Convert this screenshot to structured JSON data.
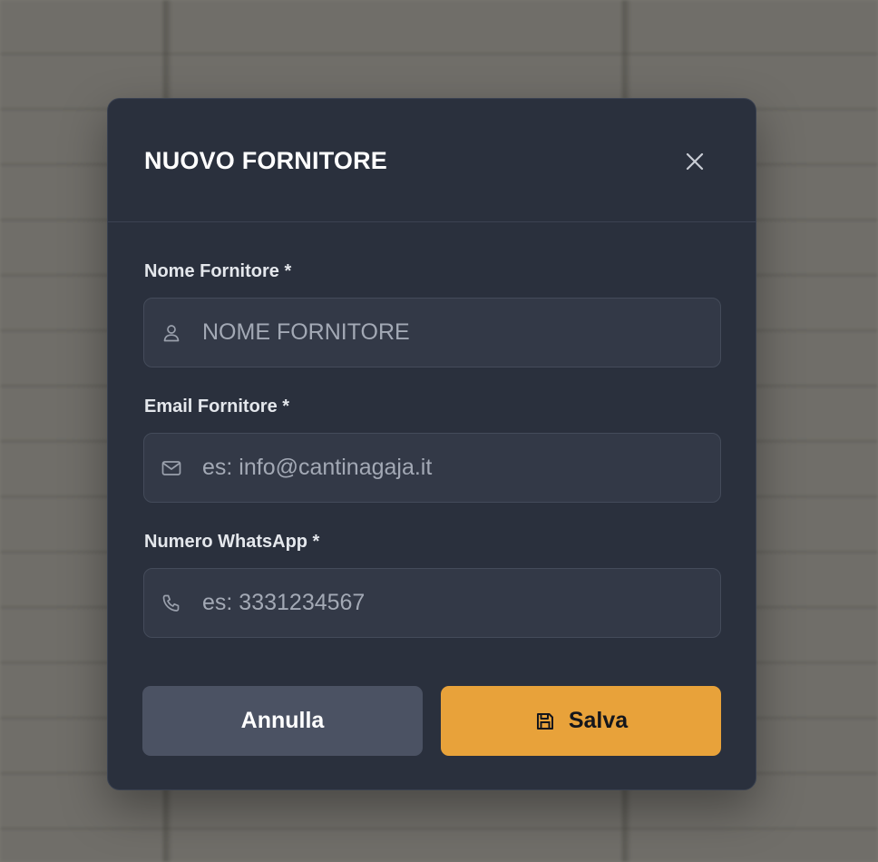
{
  "modal": {
    "title": "NUOVO FORNITORE",
    "close_icon": "close-icon"
  },
  "form": {
    "name": {
      "label": "Nome Fornitore *",
      "placeholder": "NOME FORNITORE",
      "value": "",
      "icon": "user-icon"
    },
    "email": {
      "label": "Email Fornitore *",
      "placeholder": "es: info@cantinagaja.it",
      "value": "",
      "icon": "mail-icon"
    },
    "whatsapp": {
      "label": "Numero WhatsApp *",
      "placeholder": "es: 3331234567",
      "value": "",
      "icon": "phone-icon"
    }
  },
  "actions": {
    "cancel_label": "Annulla",
    "save_label": "Salva",
    "save_icon": "save-icon"
  },
  "colors": {
    "modal_bg": "#2a303d",
    "input_bg": "#333947",
    "cancel_bg": "#4b5263",
    "accent": "#e8a23a"
  }
}
